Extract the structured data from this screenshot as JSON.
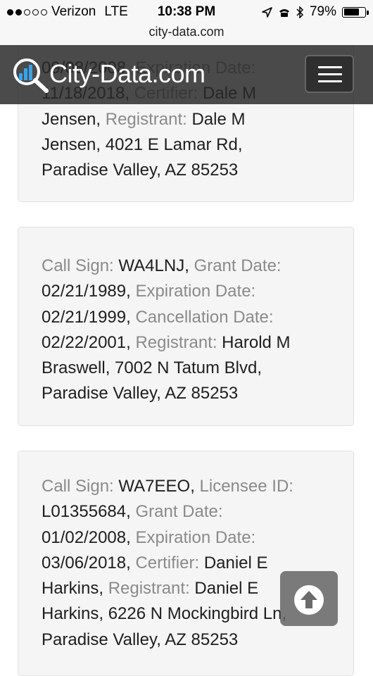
{
  "status_bar": {
    "signal_bars_filled": 2,
    "signal_bars_total": 5,
    "carrier": "Verizon",
    "network": "LTE",
    "time": "10:38 PM",
    "battery_percent": "79%",
    "battery_level": 0.79,
    "icons": [
      "location-arrow-icon",
      "alarm-icon",
      "bluetooth-icon"
    ]
  },
  "browser": {
    "url": "city-data.com"
  },
  "header": {
    "brand": "City-Data.com",
    "logo_icon": "magnifier-chart-icon",
    "menu_icon": "hamburger-menu-icon"
  },
  "records": [
    {
      "lines": [
        [
          {
            "k": "",
            "v": "09/08/2008, "
          },
          {
            "k": "Expiration Date:",
            "v": ""
          }
        ],
        [
          {
            "k": "",
            "v": "11/18/2018, "
          },
          {
            "k": "Certifier: ",
            "v": "Dale M"
          }
        ],
        [
          {
            "k": "",
            "v": "Jensen, "
          },
          {
            "k": "Registrant: ",
            "v": "Dale M"
          }
        ],
        [
          {
            "k": "",
            "v": "Jensen, 4021 E Lamar Rd,"
          }
        ],
        [
          {
            "k": "",
            "v": "Paradise Valley, AZ 85253"
          }
        ]
      ]
    },
    {
      "lines": [
        [
          {
            "k": "Call Sign: ",
            "v": "WA4LNJ, "
          },
          {
            "k": "Grant Date:",
            "v": ""
          }
        ],
        [
          {
            "k": "",
            "v": "02/21/1989, "
          },
          {
            "k": "Expiration Date:",
            "v": ""
          }
        ],
        [
          {
            "k": "",
            "v": "02/21/1999, "
          },
          {
            "k": "Cancellation Date:",
            "v": ""
          }
        ],
        [
          {
            "k": "",
            "v": "02/22/2001, "
          },
          {
            "k": "Registrant: ",
            "v": "Harold M"
          }
        ],
        [
          {
            "k": "",
            "v": "Braswell, 7002 N Tatum Blvd,"
          }
        ],
        [
          {
            "k": "",
            "v": "Paradise Valley, AZ 85253"
          }
        ]
      ]
    },
    {
      "lines": [
        [
          {
            "k": "Call Sign: ",
            "v": "WA7EEO, "
          },
          {
            "k": "Licensee ID:",
            "v": ""
          }
        ],
        [
          {
            "k": "",
            "v": "L01355684, "
          },
          {
            "k": "Grant Date:",
            "v": ""
          }
        ],
        [
          {
            "k": "",
            "v": "01/02/2008, "
          },
          {
            "k": "Expiration Date:",
            "v": ""
          }
        ],
        [
          {
            "k": "",
            "v": "03/06/2018, "
          },
          {
            "k": "Certifier: ",
            "v": "Daniel E"
          }
        ],
        [
          {
            "k": "",
            "v": "Harkins, "
          },
          {
            "k": "Registrant: ",
            "v": "Daniel E"
          }
        ],
        [
          {
            "k": "",
            "v": "Harkins, 6226 N Mockingbird Ln,"
          }
        ],
        [
          {
            "k": "",
            "v": "Paradise Valley, AZ 85253"
          }
        ]
      ]
    }
  ],
  "scroll_top_button": {
    "icon": "arrow-up-circle-icon"
  }
}
